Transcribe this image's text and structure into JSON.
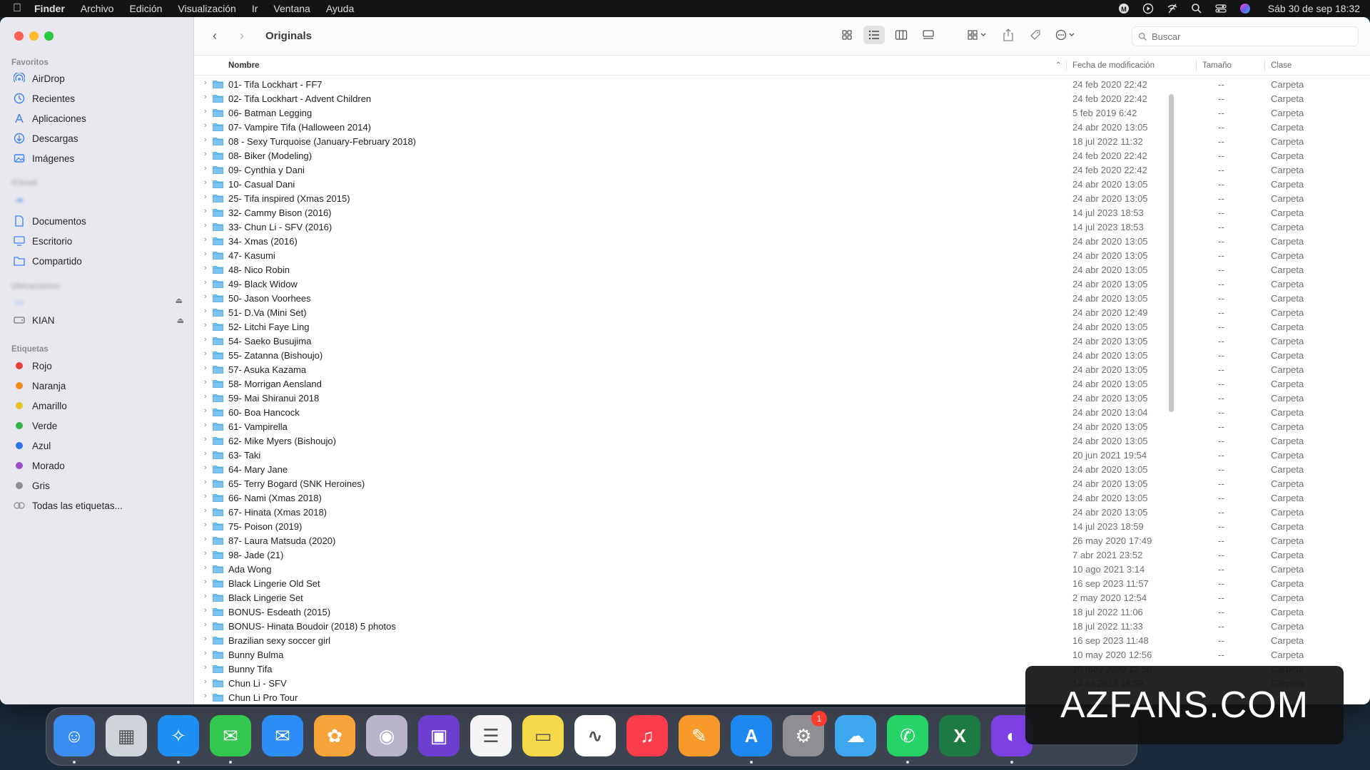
{
  "menubar": {
    "app": "Finder",
    "items": [
      "Archivo",
      "Edición",
      "Visualización",
      "Ir",
      "Ventana",
      "Ayuda"
    ],
    "clock": "Sáb 30 de sep  18:32"
  },
  "sidebar": {
    "favorites_title": "Favoritos",
    "favorites": [
      "AirDrop",
      "Recientes",
      "Aplicaciones",
      "Descargas",
      "Imágenes"
    ],
    "icloud_title": "iCloud",
    "icloud": [
      "Documentos",
      "Escritorio",
      "Compartido"
    ],
    "locations_title": "Ubicaciones",
    "locations": [
      "KIAN"
    ],
    "tags_title": "Etiquetas",
    "tags": [
      {
        "label": "Rojo",
        "color": "#e5413b"
      },
      {
        "label": "Naranja",
        "color": "#f08c1a"
      },
      {
        "label": "Amarillo",
        "color": "#e8c21d"
      },
      {
        "label": "Verde",
        "color": "#35b34a"
      },
      {
        "label": "Azul",
        "color": "#2f74e8"
      },
      {
        "label": "Morado",
        "color": "#9b4fc4"
      },
      {
        "label": "Gris",
        "color": "#8e8e93"
      }
    ],
    "all_tags": "Todas las etiquetas..."
  },
  "toolbar": {
    "title": "Originals",
    "search_placeholder": "Buscar"
  },
  "columns": {
    "name": "Nombre",
    "date": "Fecha de modificación",
    "size": "Tamaño",
    "kind": "Clase"
  },
  "rows": [
    {
      "name": "01- Tifa Lockhart - FF7",
      "date": "24 feb 2020 22:42",
      "size": "--",
      "kind": "Carpeta"
    },
    {
      "name": "02- Tifa Lockhart - Advent Children",
      "date": "24 feb 2020 22:42",
      "size": "--",
      "kind": "Carpeta"
    },
    {
      "name": "06- Batman Legging",
      "date": "5 feb 2019 6:42",
      "size": "--",
      "kind": "Carpeta"
    },
    {
      "name": "07- Vampire Tifa (Halloween 2014)",
      "date": "24 abr 2020 13:05",
      "size": "--",
      "kind": "Carpeta"
    },
    {
      "name": "08 - Sexy Turquoise (January-February 2018)",
      "date": "18 jul 2022 11:32",
      "size": "--",
      "kind": "Carpeta"
    },
    {
      "name": "08- Biker (Modeling)",
      "date": "24 feb 2020 22:42",
      "size": "--",
      "kind": "Carpeta"
    },
    {
      "name": "09- Cynthia y Dani",
      "date": "24 feb 2020 22:42",
      "size": "--",
      "kind": "Carpeta"
    },
    {
      "name": "10- Casual Dani",
      "date": "24 abr 2020 13:05",
      "size": "--",
      "kind": "Carpeta"
    },
    {
      "name": "25- Tifa inspired (Xmas 2015)",
      "date": "24 abr 2020 13:05",
      "size": "--",
      "kind": "Carpeta"
    },
    {
      "name": "32- Cammy Bison (2016)",
      "date": "14 jul 2023 18:53",
      "size": "--",
      "kind": "Carpeta"
    },
    {
      "name": "33- Chun Li - SFV (2016)",
      "date": "14 jul 2023 18:53",
      "size": "--",
      "kind": "Carpeta"
    },
    {
      "name": "34- Xmas (2016)",
      "date": "24 abr 2020 13:05",
      "size": "--",
      "kind": "Carpeta"
    },
    {
      "name": "47- Kasumi",
      "date": "24 abr 2020 13:05",
      "size": "--",
      "kind": "Carpeta"
    },
    {
      "name": "48- Nico Robin",
      "date": "24 abr 2020 13:05",
      "size": "--",
      "kind": "Carpeta"
    },
    {
      "name": "49- Black Widow",
      "date": "24 abr 2020 13:05",
      "size": "--",
      "kind": "Carpeta"
    },
    {
      "name": "50- Jason Voorhees",
      "date": "24 abr 2020 13:05",
      "size": "--",
      "kind": "Carpeta"
    },
    {
      "name": "51- D.Va (Mini Set)",
      "date": "24 abr 2020 12:49",
      "size": "--",
      "kind": "Carpeta"
    },
    {
      "name": "52- Litchi Faye Ling",
      "date": "24 abr 2020 13:05",
      "size": "--",
      "kind": "Carpeta"
    },
    {
      "name": "54- Saeko Busujima",
      "date": "24 abr 2020 13:05",
      "size": "--",
      "kind": "Carpeta"
    },
    {
      "name": "55- Zatanna (Bishoujo)",
      "date": "24 abr 2020 13:05",
      "size": "--",
      "kind": "Carpeta"
    },
    {
      "name": "57- Asuka Kazama",
      "date": "24 abr 2020 13:05",
      "size": "--",
      "kind": "Carpeta"
    },
    {
      "name": "58- Morrigan Aensland",
      "date": "24 abr 2020 13:05",
      "size": "--",
      "kind": "Carpeta"
    },
    {
      "name": "59- Mai Shiranui 2018",
      "date": "24 abr 2020 13:05",
      "size": "--",
      "kind": "Carpeta"
    },
    {
      "name": "60- Boa Hancock",
      "date": "24 abr 2020 13:04",
      "size": "--",
      "kind": "Carpeta"
    },
    {
      "name": "61- Vampirella",
      "date": "24 abr 2020 13:05",
      "size": "--",
      "kind": "Carpeta"
    },
    {
      "name": "62- Mike Myers (Bishoujo)",
      "date": "24 abr 2020 13:05",
      "size": "--",
      "kind": "Carpeta"
    },
    {
      "name": "63- Taki",
      "date": "20 jun 2021 19:54",
      "size": "--",
      "kind": "Carpeta"
    },
    {
      "name": "64- Mary Jane",
      "date": "24 abr 2020 13:05",
      "size": "--",
      "kind": "Carpeta"
    },
    {
      "name": "65- Terry Bogard (SNK Heroines)",
      "date": "24 abr 2020 13:05",
      "size": "--",
      "kind": "Carpeta"
    },
    {
      "name": "66- Nami (Xmas 2018)",
      "date": "24 abr 2020 13:05",
      "size": "--",
      "kind": "Carpeta"
    },
    {
      "name": "67- Hinata (Xmas 2018)",
      "date": "24 abr 2020 13:05",
      "size": "--",
      "kind": "Carpeta"
    },
    {
      "name": "75- Poison (2019)",
      "date": "14 jul 2023 18:59",
      "size": "--",
      "kind": "Carpeta"
    },
    {
      "name": "87- Laura Matsuda (2020)",
      "date": "26 may 2020 17:49",
      "size": "--",
      "kind": "Carpeta"
    },
    {
      "name": "98- Jade (21)",
      "date": "7 abr 2021 23:52",
      "size": "--",
      "kind": "Carpeta"
    },
    {
      "name": "Ada Wong",
      "date": "10 ago 2021 3:14",
      "size": "--",
      "kind": "Carpeta"
    },
    {
      "name": "Black Lingerie Old Set",
      "date": "16 sep 2023 11:57",
      "size": "--",
      "kind": "Carpeta"
    },
    {
      "name": "Black Lingerie Set",
      "date": "2 may 2020 12:54",
      "size": "--",
      "kind": "Carpeta"
    },
    {
      "name": "BONUS- Esdeath (2015)",
      "date": "18 jul 2022 11:06",
      "size": "--",
      "kind": "Carpeta"
    },
    {
      "name": "BONUS- Hinata Boudoir (2018) 5 photos",
      "date": "18 jul 2022 11:33",
      "size": "--",
      "kind": "Carpeta"
    },
    {
      "name": "Brazilian sexy soccer girl",
      "date": "16 sep 2023 11:48",
      "size": "--",
      "kind": "Carpeta"
    },
    {
      "name": "Bunny Bulma",
      "date": "10 may 2020 12:56",
      "size": "--",
      "kind": "Carpeta"
    },
    {
      "name": "Bunny Tifa",
      "date": "10 may 2020 12:56",
      "size": "--",
      "kind": "Carpeta"
    },
    {
      "name": "Chun Li - SFV",
      "date": "14 jul 2023 18:59",
      "size": "--",
      "kind": "Carpeta"
    },
    {
      "name": "Chun Li Pro Tour",
      "date": "",
      "size": "",
      "kind": ""
    }
  ],
  "dock": {
    "apps": [
      {
        "name": "finder",
        "color": "#3b8cf0",
        "glyph": "☺"
      },
      {
        "name": "launchpad",
        "color": "#cfd3da",
        "glyph": "▦"
      },
      {
        "name": "safari",
        "color": "#1e8ff2",
        "glyph": "✧"
      },
      {
        "name": "messages",
        "color": "#33c74f",
        "glyph": "✉"
      },
      {
        "name": "mail",
        "color": "#2b8df5",
        "glyph": "✉"
      },
      {
        "name": "photos",
        "color": "#f6a43a",
        "glyph": "✿"
      },
      {
        "name": "image-app",
        "color": "#b9b3c9",
        "glyph": "◉"
      },
      {
        "name": "podcast-app",
        "color": "#6d3fd1",
        "glyph": "▣"
      },
      {
        "name": "reminders",
        "color": "#f4f4f4",
        "glyph": "☰"
      },
      {
        "name": "notes",
        "color": "#f6d94a",
        "glyph": "▭"
      },
      {
        "name": "freeform",
        "color": "#ffffff",
        "glyph": "∿"
      },
      {
        "name": "music",
        "color": "#fa3c4c",
        "glyph": "♫"
      },
      {
        "name": "pages",
        "color": "#f79a2a",
        "glyph": "✎"
      },
      {
        "name": "app-store",
        "color": "#1e88f0",
        "glyph": "A"
      },
      {
        "name": "system-settings",
        "color": "#8e8e93",
        "glyph": "⚙",
        "badge": "1"
      },
      {
        "name": "cloud-app",
        "color": "#3fa7f0",
        "glyph": "☁"
      },
      {
        "name": "whatsapp",
        "color": "#25d366",
        "glyph": "✆"
      },
      {
        "name": "excel",
        "color": "#1d7a43",
        "glyph": "X"
      },
      {
        "name": "firefox",
        "color": "#7b3fe4",
        "glyph": "◐"
      }
    ]
  },
  "watermark": "AZFANS.COM"
}
